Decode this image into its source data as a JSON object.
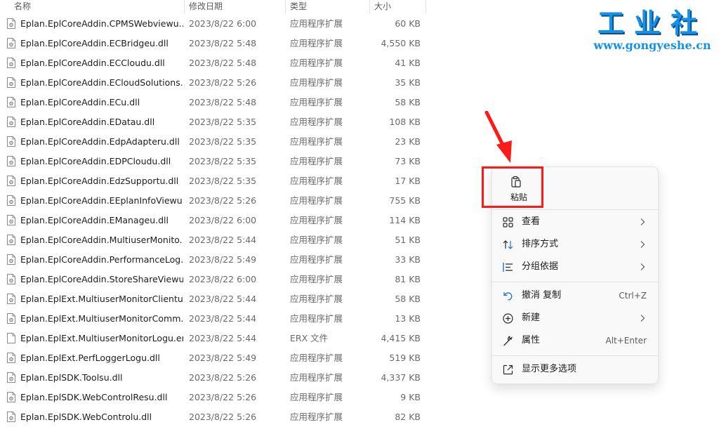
{
  "columns": {
    "name": "名称",
    "date": "修改日期",
    "type": "类型",
    "size": "大小"
  },
  "files": [
    {
      "name": "Eplan.EplCoreAddin.CPMSWebviewu....",
      "date": "2023/8/22 6:00",
      "type": "应用程序扩展",
      "size": "60 KB"
    },
    {
      "name": "Eplan.EplCoreAddin.ECBridgeu.dll",
      "date": "2023/8/22 5:48",
      "type": "应用程序扩展",
      "size": "4,550 KB"
    },
    {
      "name": "Eplan.EplCoreAddin.ECCloudu.dll",
      "date": "2023/8/22 5:48",
      "type": "应用程序扩展",
      "size": "41 KB"
    },
    {
      "name": "Eplan.EplCoreAddin.ECloudSolutions....",
      "date": "2023/8/22 5:26",
      "type": "应用程序扩展",
      "size": "35 KB"
    },
    {
      "name": "Eplan.EplCoreAddin.ECu.dll",
      "date": "2023/8/22 5:48",
      "type": "应用程序扩展",
      "size": "58 KB"
    },
    {
      "name": "Eplan.EplCoreAddin.EDatau.dll",
      "date": "2023/8/22 5:35",
      "type": "应用程序扩展",
      "size": "108 KB"
    },
    {
      "name": "Eplan.EplCoreAddin.EdpAdapteru.dll",
      "date": "2023/8/22 5:35",
      "type": "应用程序扩展",
      "size": "23 KB"
    },
    {
      "name": "Eplan.EplCoreAddin.EDPCloudu.dll",
      "date": "2023/8/22 5:35",
      "type": "应用程序扩展",
      "size": "73 KB"
    },
    {
      "name": "Eplan.EplCoreAddin.EdzSupportu.dll",
      "date": "2023/8/22 5:35",
      "type": "应用程序扩展",
      "size": "17 KB"
    },
    {
      "name": "Eplan.EplCoreAddin.EEplanInfoViewu....",
      "date": "2023/8/22 5:26",
      "type": "应用程序扩展",
      "size": "755 KB"
    },
    {
      "name": "Eplan.EplCoreAddin.EManageu.dll",
      "date": "2023/8/22 6:00",
      "type": "应用程序扩展",
      "size": "114 KB"
    },
    {
      "name": "Eplan.EplCoreAddin.MultiuserMonito....",
      "date": "2023/8/22 5:44",
      "type": "应用程序扩展",
      "size": "51 KB"
    },
    {
      "name": "Eplan.EplCoreAddin.PerformanceLog....",
      "date": "2023/8/22 5:49",
      "type": "应用程序扩展",
      "size": "33 KB"
    },
    {
      "name": "Eplan.EplCoreAddin.StoreShareViewu....",
      "date": "2023/8/22 6:00",
      "type": "应用程序扩展",
      "size": "81 KB"
    },
    {
      "name": "Eplan.EplExt.MultiuserMonitorClientu....",
      "date": "2023/8/22 5:44",
      "type": "应用程序扩展",
      "size": "58 KB"
    },
    {
      "name": "Eplan.EplExt.MultiuserMonitorComm....",
      "date": "2023/8/22 5:44",
      "type": "应用程序扩展",
      "size": "13 KB"
    },
    {
      "name": "Eplan.EplExt.MultiuserMonitorLogu.erx",
      "date": "2023/8/22 5:44",
      "type": "ERX 文件",
      "size": "4,415 KB",
      "plain": true
    },
    {
      "name": "Eplan.EplExt.PerfLoggerLogu.dll",
      "date": "2023/8/22 5:49",
      "type": "应用程序扩展",
      "size": "519 KB"
    },
    {
      "name": "Eplan.EplSDK.Toolsu.dll",
      "date": "2023/8/22 5:26",
      "type": "应用程序扩展",
      "size": "4,337 KB"
    },
    {
      "name": "Eplan.EplSDK.WebControlResu.dll",
      "date": "2023/8/22 5:26",
      "type": "应用程序扩展",
      "size": "9 KB"
    },
    {
      "name": "Eplan.EplSDK.WebControlu.dll",
      "date": "2023/8/22 5:26",
      "type": "应用程序扩展",
      "size": "82 KB"
    }
  ],
  "logo": {
    "title": "工业社",
    "url": "www.gongyeshe.cn"
  },
  "menu": {
    "paste": "粘贴",
    "view": "查看",
    "sort": "排序方式",
    "group": "分组依据",
    "undo": "撤消 复制",
    "undo_shortcut": "Ctrl+Z",
    "new": "新建",
    "properties": "属性",
    "properties_shortcut": "Alt+Enter",
    "more": "显示更多选项"
  },
  "colors": {
    "accent": "#1592e8",
    "annotation": "#ff1a1a"
  }
}
